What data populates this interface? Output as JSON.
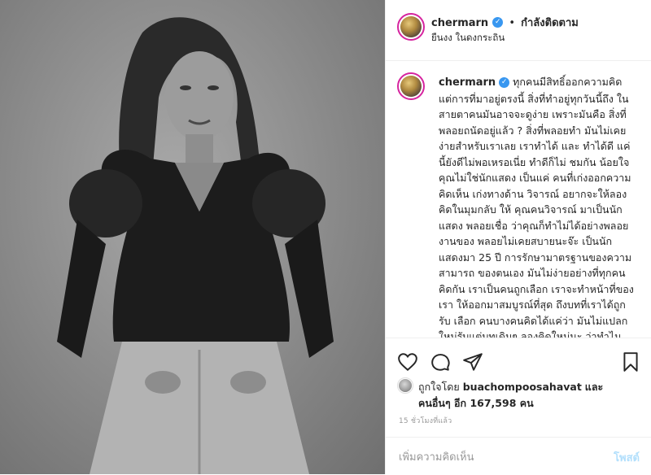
{
  "header": {
    "username": "chermarn",
    "separator": "•",
    "follow_status": "กำลังติดตาม",
    "location": "ยืนงง ในดงกระถิน"
  },
  "caption": {
    "username": "chermarn",
    "text": "ทุกคนมีสิทธิ์ออกความคิด แต่การที่มาอยู่ตรงนี้ สิ่งที่ทำอยู่ทุกวันนี้ถึง ในสายตาคนมันอาจจะดูง่าย เพราะมันคือ สิ่งที่พลอยถนัดอยู่แล้ว ? สิ่งที่พลอยทำ มันไม่เคยง่ายสำหรับเราเลย เราทำได้ และ ทำได้ดี แค่นี้ยังดีไม่พอเหรอเนี่ย ทำดีก็ไม่ ชมกัน น้อยใจ คุณไม่ใช่นักแสดง เป็นแค่ คนที่เก่งออกความคิดเห็น เก่งทางด้าน วิจารณ์ อยากจะให้ลองคิดในมุมกลับ ให้ คุณคนวิจารณ์ มาเป็นนักแสดง พลอยเชื่อ ว่าคุณก็ทำไม่ได้อย่างพลอย งานของ พลอยไม่เคยสบายนะจ๊ะ เป็นนักแสดงมา 25 ปี การรักษามาตรฐานของความสามารถ ของตนเอง มันไม่ง่ายอย่างที่ทุกคนคิดกัน เราเป็นคนถูกเลือก เราจะทำหน้าที่ของเรา ให้ออกมาสมบูรณ์ที่สุด ถึงบทที่เราได้ถูกรับ เลือก คนบางคนคิดได้แค่ว่า มันไม่แปลก ใหม่รับแต่บทเดิมๆ ลองคิดใหม่นะ ว่าทำไม"
  },
  "actions": {
    "like_icon": "heart-icon",
    "comment_icon": "comment-icon",
    "share_icon": "share-icon",
    "save_icon": "bookmark-icon"
  },
  "likes": {
    "prefix": "ถูกใจโดย",
    "liker": "buachompoosahavat",
    "conjunction": "และ",
    "others_label": "คนอื่นๆ อีก 167,598 คน"
  },
  "timestamp": "15 ชั่วโมงที่แล้ว",
  "comment": {
    "placeholder": "เพิ่มความคิดเห็น",
    "post_label": "โพสต์"
  },
  "colors": {
    "verified": "#3897f0",
    "post_disabled": "#b2dffc",
    "story_ring": "#d6249f"
  }
}
